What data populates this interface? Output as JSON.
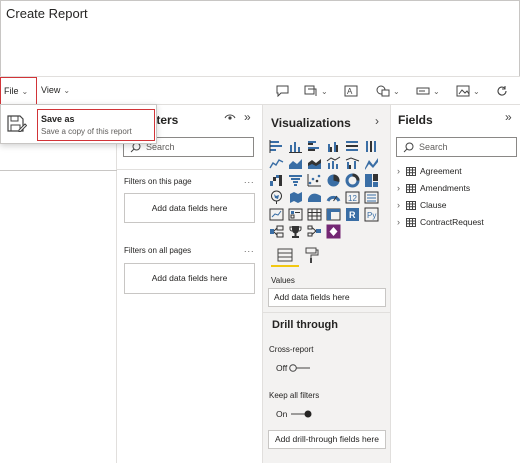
{
  "window": {
    "title": "Create Report"
  },
  "ribbon": {
    "file_label": "File",
    "view_label": "View"
  },
  "file_menu": {
    "save_as_title": "Save as",
    "save_as_desc": "Save a copy of this report"
  },
  "filters": {
    "title": "lters",
    "search_placeholder": "Search",
    "on_this_page_label": "Filters on this page",
    "on_all_pages_label": "Filters on all pages",
    "add_fields_label": "Add data fields here",
    "more": "..."
  },
  "visualizations": {
    "title": "Visualizations",
    "values_label": "Values",
    "values_placeholder": "Add data fields here",
    "drill_title": "Drill through",
    "cross_report_label": "Cross-report",
    "cross_report_state": "Off",
    "keep_filters_label": "Keep all filters",
    "keep_filters_state": "On",
    "drill_placeholder": "Add drill-through fields here",
    "icons": [
      "stacked-bar-icon",
      "stacked-column-icon",
      "clustered-bar-icon",
      "clustered-column-icon",
      "100-bar-icon",
      "100-column-icon",
      "line-chart-icon",
      "area-chart-icon",
      "stacked-area-icon",
      "line-column-icon",
      "line-clustered-icon",
      "ribbon-chart-icon",
      "waterfall-icon",
      "funnel-icon",
      "scatter-icon",
      "pie-icon",
      "donut-icon",
      "treemap-icon",
      "map-icon",
      "filled-map-icon",
      "shape-map-icon",
      "gauge-icon",
      "card-icon",
      "multirow-card-icon",
      "kpi-icon",
      "slicer-icon",
      "table-icon",
      "matrix-icon",
      "r-visual-icon",
      "python-visual-icon",
      "key-influencers-icon",
      "trophy-icon",
      "decomposition-icon",
      "powerapps-icon"
    ]
  },
  "fields": {
    "title": "Fields",
    "search_placeholder": "Search",
    "tables": [
      {
        "label": "Agreement"
      },
      {
        "label": "Amendments"
      },
      {
        "label": "Clause"
      },
      {
        "label": "ContractRequest"
      }
    ]
  },
  "colors": {
    "accent": "#118dff",
    "highlight": "#d13438",
    "selected_underline": "#f2c811",
    "purple_visual": "#742774"
  }
}
